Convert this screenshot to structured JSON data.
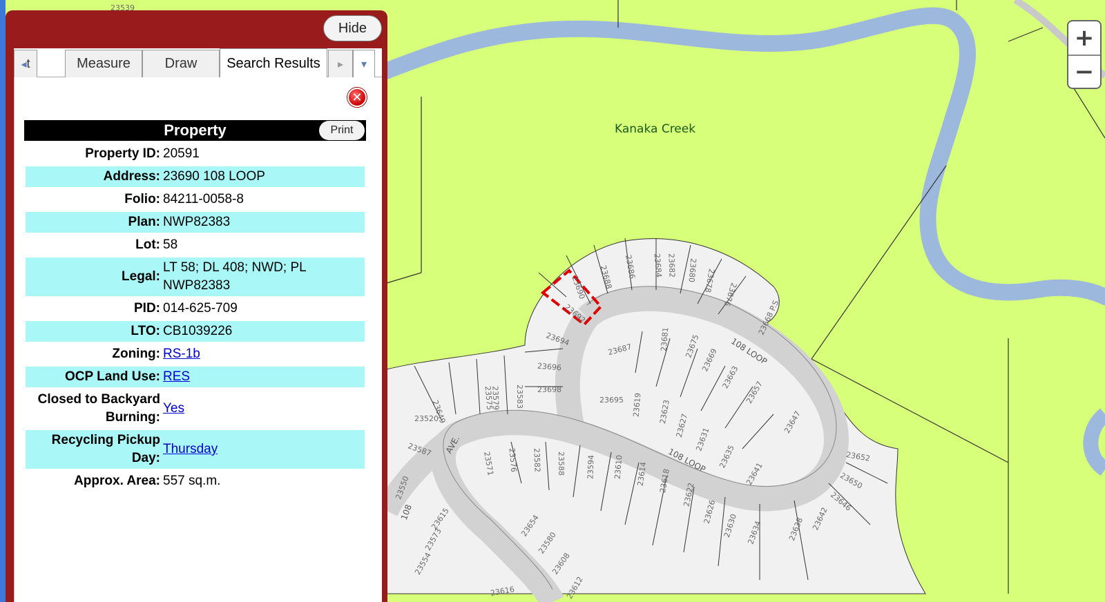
{
  "map": {
    "labels": {
      "creek": "Kanaka Creek",
      "loop_north": "108 LOOP",
      "loop_south": "108 LOOP",
      "ave": "AVE.",
      "street_108": "108",
      "place": "23668 P.S."
    },
    "lot_numbers": [
      "23539",
      "23690",
      "23688",
      "23686",
      "23684",
      "23682",
      "23680",
      "23678",
      "23676",
      "23692",
      "23694",
      "23696",
      "23698",
      "23687",
      "23681",
      "23675",
      "23669",
      "23663",
      "23657",
      "23695",
      "23619",
      "23623",
      "23627",
      "23631",
      "23635",
      "23641",
      "23647",
      "23649",
      "23575",
      "23579",
      "23583",
      "23587",
      "23571",
      "23576",
      "23582",
      "23588",
      "23594",
      "23610",
      "23614",
      "23618",
      "23622",
      "23626",
      "23630",
      "23634",
      "23638",
      "23642",
      "23646",
      "23650",
      "23652",
      "23654",
      "23580",
      "23608",
      "23612",
      "23616",
      "23615",
      "23573",
      "23554",
      "23550",
      "23520"
    ],
    "colors": {
      "land": "#d8ff7a",
      "water": "#9cb8dd",
      "lots": "#f1f1f1",
      "roads": "#d2d2d2",
      "selected": "#e00000"
    }
  },
  "zoom": {
    "in_label": "+",
    "out_label": "−"
  },
  "panel": {
    "hide_label": "Hide",
    "tabs": [
      {
        "label": "t",
        "prefix": "◂"
      },
      {
        "label": "Measure"
      },
      {
        "label": "Draw"
      },
      {
        "label": "Search Results"
      }
    ],
    "next_arrow": "▸",
    "menu_arrow": "▾",
    "close_icon": "✕",
    "header": "Property",
    "print_label": "Print",
    "fields": [
      {
        "key": "Property ID:",
        "value": "20591"
      },
      {
        "key": "Address:",
        "value": "23690 108 LOOP"
      },
      {
        "key": "Folio:",
        "value": "84211-0058-8"
      },
      {
        "key": "Plan:",
        "value": "NWP82383"
      },
      {
        "key": "Lot:",
        "value": "58"
      },
      {
        "key": "Legal:",
        "value": "LT 58; DL 408; NWD; PL NWP82383"
      },
      {
        "key": "PID:",
        "value": "014-625-709"
      },
      {
        "key": "LTO:",
        "value": "CB1039226"
      },
      {
        "key": "Zoning:",
        "value": "RS-1b",
        "link": true
      },
      {
        "key": "OCP Land Use:",
        "value": "RES",
        "link": true
      },
      {
        "key": "Closed to Backyard Burning:",
        "value": "Yes",
        "link": true
      },
      {
        "key": "Recycling Pickup Day:",
        "value": "Thursday",
        "link": true
      },
      {
        "key": "Approx. Area:",
        "value": "557 sq.m."
      }
    ]
  }
}
